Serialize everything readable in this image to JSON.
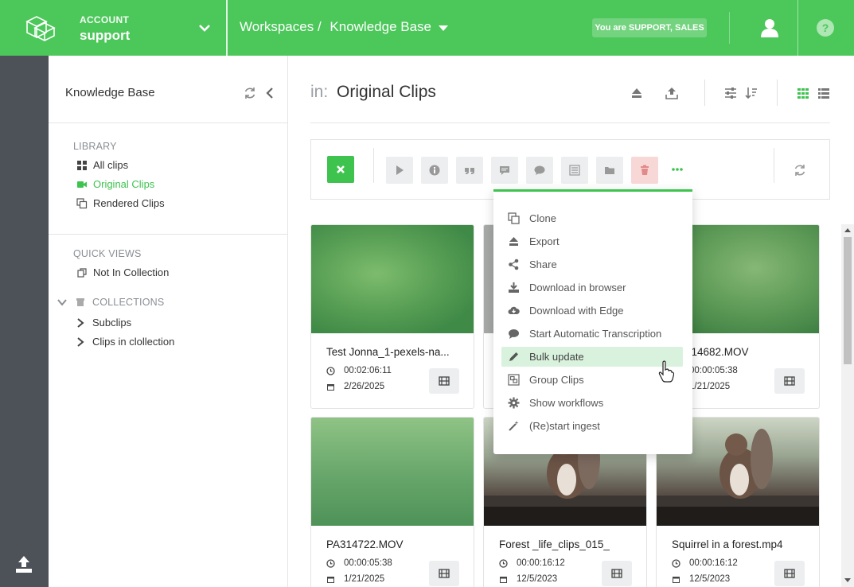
{
  "topbar": {
    "account_label": "ACCOUNT",
    "account_value": "support",
    "breadcrumb_workspaces": "Workspaces /",
    "breadcrumb_current": "Knowledge Base",
    "role_text": "You are SUPPORT, SALES"
  },
  "sidebar": {
    "title": "Knowledge Base",
    "library_title": "LIBRARY",
    "library_items": [
      {
        "label": "All clips",
        "icon": "grid-icon"
      },
      {
        "label": "Original Clips",
        "icon": "video-camera-icon",
        "active": true
      },
      {
        "label": "Rendered Clips",
        "icon": "copy-icon"
      }
    ],
    "quick_views_title": "QUICK VIEWS",
    "quick_items": [
      {
        "label": "Not In Collection",
        "icon": "unlink-icon"
      }
    ],
    "collections_title": "COLLECTIONS",
    "collection_items": [
      {
        "label": "Subclips"
      },
      {
        "label": "Clips in clollection"
      }
    ]
  },
  "main": {
    "title_prefix": "in:",
    "title": "Original Clips"
  },
  "menu": {
    "items": [
      {
        "label": "Clone",
        "icon": "clone-icon"
      },
      {
        "label": "Export",
        "icon": "eject-icon"
      },
      {
        "label": "Share",
        "icon": "share-icon"
      },
      {
        "label": "Download in browser",
        "icon": "download-icon"
      },
      {
        "label": "Download with Edge",
        "icon": "cloud-download-icon"
      },
      {
        "label": "Start Automatic Transcription",
        "icon": "comment-icon"
      },
      {
        "label": "Bulk update",
        "icon": "pencil-icon",
        "highlighted": true
      },
      {
        "label": "Group Clips",
        "icon": "group-icon"
      },
      {
        "label": "Show workflows",
        "icon": "cog-icon"
      },
      {
        "label": "(Re)start ingest",
        "icon": "magic-wand-icon"
      }
    ]
  },
  "cards": [
    {
      "name": "Test Jonna_1-pexels-na...",
      "duration": "00:02:06:11",
      "date": "2/26/2025"
    },
    {
      "name": "",
      "duration": "",
      "date": ""
    },
    {
      "name": "PA314682.MOV",
      "duration": "00:00:05:38",
      "date": "1/21/2025"
    },
    {
      "name": "PA314722.MOV",
      "duration": "00:00:05:38",
      "date": "1/21/2025"
    },
    {
      "name": "Forest _life_clips_015_",
      "duration": "00:00:16:12",
      "date": "12/5/2023"
    },
    {
      "name": "Squirrel in a forest.mp4",
      "duration": "00:00:16:12",
      "date": "12/5/2023"
    }
  ],
  "colors": {
    "accent": "#4cc75a",
    "rail": "#4c5258",
    "danger": "#f8d7d7"
  }
}
